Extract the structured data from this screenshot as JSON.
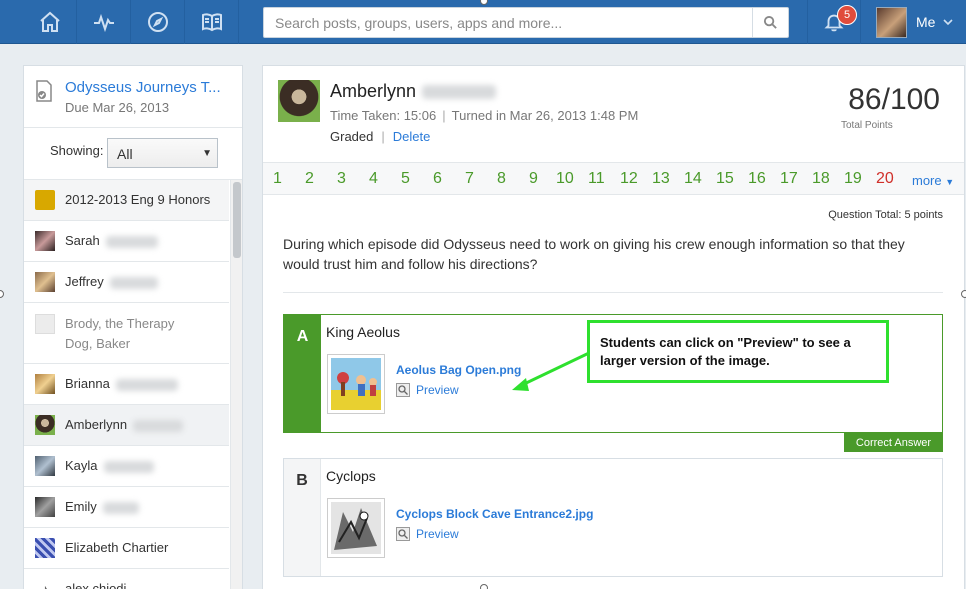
{
  "nav": {
    "icons": [
      "home-icon",
      "activity-icon",
      "compass-icon",
      "book-icon"
    ]
  },
  "search": {
    "placeholder": "Search posts, groups, users, apps and more..."
  },
  "notifications": {
    "count": "5"
  },
  "user": {
    "label": "Me"
  },
  "assignment": {
    "title": "Odysseus Journeys T...",
    "due": "Due Mar 26, 2013"
  },
  "filter": {
    "label": "Showing:",
    "value": "All"
  },
  "roster": [
    {
      "name": "2012-2013 Eng 9 Honors",
      "type": "course",
      "color": "#d8a800"
    },
    {
      "name": "Sarah",
      "type": "student"
    },
    {
      "name": "Jeffrey",
      "type": "student"
    },
    {
      "name": "Brody, the Therapy Dog, Baker",
      "type": "inactive"
    },
    {
      "name": "Brianna",
      "type": "student"
    },
    {
      "name": "Amberlynn",
      "type": "selected"
    },
    {
      "name": "Kayla",
      "type": "student"
    },
    {
      "name": "Emily",
      "type": "student"
    },
    {
      "name": "Elizabeth Chartier",
      "type": "student"
    },
    {
      "name": "alex chiodi",
      "type": "student"
    }
  ],
  "submission": {
    "student_name": "Amberlynn",
    "time_taken": "Time Taken: 15:06",
    "turned_in": "Turned in Mar 26, 2013 1:48 PM",
    "status": "Graded",
    "delete_label": "Delete",
    "score": "86/100",
    "score_label": "Total Points"
  },
  "questions": {
    "numbers": [
      "1",
      "2",
      "3",
      "4",
      "5",
      "6",
      "7",
      "8",
      "9",
      "10",
      "11",
      "12",
      "13",
      "14",
      "15",
      "16",
      "17",
      "18",
      "19",
      "20"
    ],
    "incorrect": [
      "20"
    ],
    "more_label": "more",
    "colors": {
      "correct": "#4a9a2a",
      "incorrect": "#d0302a"
    }
  },
  "question": {
    "total": "Question Total: 5 points",
    "prompt": "During which episode did Odysseus need to work on giving his crew enough information so that they would trust him and follow his directions?",
    "answers": [
      {
        "letter": "A",
        "text": "King Aeolus",
        "file": "Aeolus Bag Open.png",
        "preview": "Preview",
        "correct": true
      },
      {
        "letter": "B",
        "text": "Cyclops",
        "file": "Cyclops Block Cave Entrance2.jpg",
        "preview": "Preview",
        "correct": false
      }
    ],
    "correct_label": "Correct Answer"
  },
  "annotation": {
    "text": "Students can click on \"Preview\" to see a larger version of the image.",
    "color": "#2ee02e"
  }
}
